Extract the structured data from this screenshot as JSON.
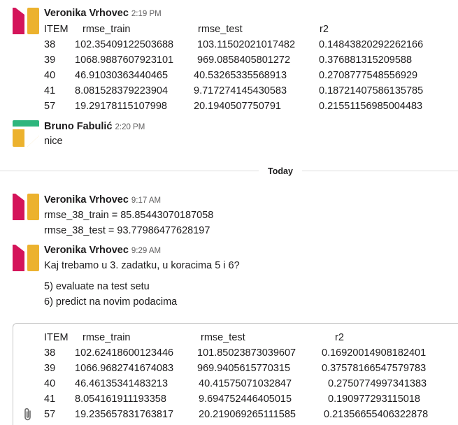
{
  "colors": {
    "pink": "#D4145A",
    "yellow": "#ECB22E",
    "green": "#2EB67D",
    "text": "#1d1c1d",
    "muted": "#616061"
  },
  "messages": [
    {
      "author": "Veronika Vrhovec",
      "time": "2:19 PM",
      "table": {
        "headers": [
          "ITEM",
          "rmse_train",
          "rmse_test",
          "r2"
        ],
        "rows": [
          [
            "38",
            "102.35409122503688",
            "103.11502021017482",
            "0.14843820292262166"
          ],
          [
            "39",
            "1068.9887607923101",
            "969.0858405801272",
            "0.376881315209588"
          ],
          [
            "40",
            "46.91030363440465",
            "40.53265335568913",
            "0.2708777548556929"
          ],
          [
            "41",
            "8.081528379223904",
            "9.717274145430583",
            "0.18721407586135785"
          ],
          [
            "57",
            "19.29178115107998",
            "20.1940507750791",
            "0.21551156985004483"
          ]
        ]
      }
    },
    {
      "author": "Bruno Fabulić",
      "time": "2:20 PM",
      "text": "nice"
    },
    {
      "author": "Veronika Vrhovec",
      "time": "9:17 AM",
      "lines": [
        "rmse_38_train = 85.85443070187058",
        "rmse_38_test = 93.77986477628197"
      ]
    },
    {
      "author": "Veronika Vrhovec",
      "time": "9:29 AM",
      "lines": [
        "Kaj trebamo u 3. zadatku, u koracima 5 i 6?",
        "5) evaluate na test setu",
        "6) predict na novim podacima"
      ]
    }
  ],
  "divider": {
    "label": "Today"
  },
  "composer": {
    "table": {
      "headers": [
        "ITEM",
        "rmse_train",
        "rmse_test",
        "r2"
      ],
      "rows": [
        [
          "38",
          "102.62418600123446",
          "101.85023873039607",
          "0.16920014908182401"
        ],
        [
          "39",
          "1066.9682741674083",
          "969.9405615770315",
          "0.37578166547579783"
        ],
        [
          "40",
          "46.46135341483213",
          "40.41575071032847",
          "0.2750774997341383"
        ],
        [
          "41",
          "8.054161911193358",
          "9.694752446405015",
          "0.190977293115018"
        ],
        [
          "57",
          "19.235657831763817",
          "20.219069265111585",
          "0.21356655406322878"
        ]
      ]
    },
    "attach_icon": "paperclip-icon"
  }
}
